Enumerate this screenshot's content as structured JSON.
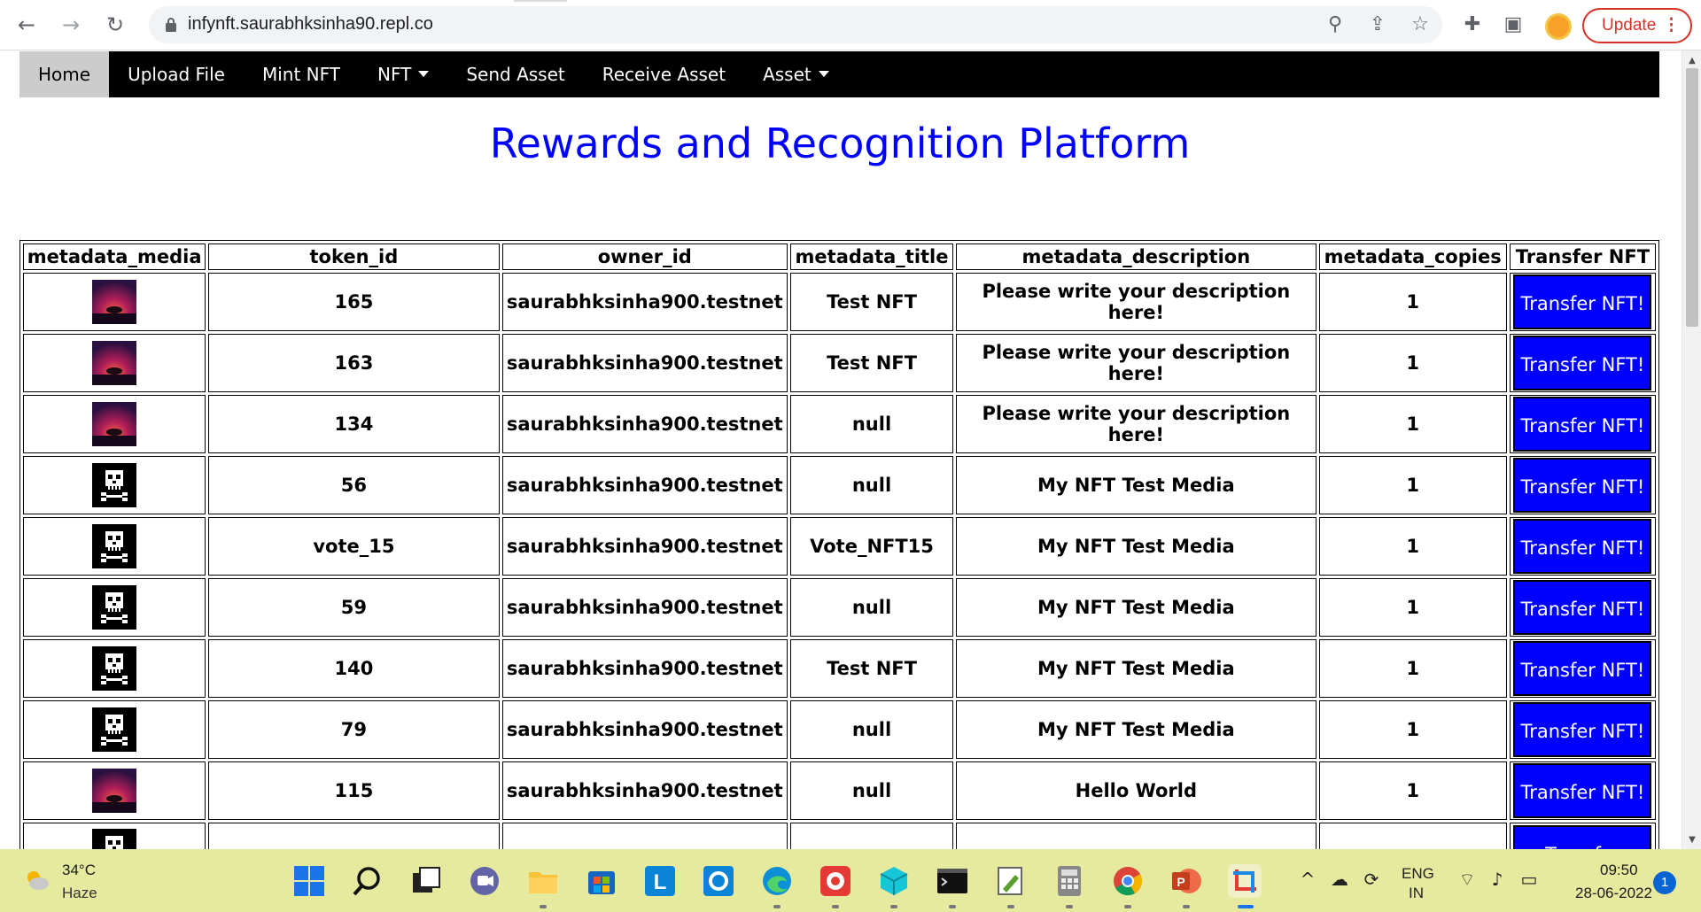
{
  "browser": {
    "url": "infynft.saurabhksinha90.repl.co",
    "update_label": "Update",
    "menu_dots": "⋮"
  },
  "nav": {
    "home": "Home",
    "upload": "Upload File",
    "mint": "Mint NFT",
    "nft": "NFT",
    "send": "Send Asset",
    "receive": "Receive Asset",
    "asset": "Asset"
  },
  "page_title": "Rewards and Recognition Platform",
  "table": {
    "headers": [
      "metadata_media",
      "token_id",
      "owner_id",
      "metadata_title",
      "metadata_description",
      "metadata_copies",
      "Transfer NFT"
    ],
    "button_label": "Transfer NFT!",
    "partial_button_label": "Transfer",
    "rows": [
      {
        "media": "sunset-tree-image",
        "token_id": "165",
        "owner_id": "saurabhksinha900.testnet",
        "title": "Test NFT",
        "description": "Please write your description here!",
        "copies": "1"
      },
      {
        "media": "sunset-tree-image",
        "token_id": "163",
        "owner_id": "saurabhksinha900.testnet",
        "title": "Test NFT",
        "description": "Please write your description here!",
        "copies": "1"
      },
      {
        "media": "sunset-tree-image",
        "token_id": "134",
        "owner_id": "saurabhksinha900.testnet",
        "title": "null",
        "description": "Please write your description here!",
        "copies": "1"
      },
      {
        "media": "pixel-skull-image",
        "token_id": "56",
        "owner_id": "saurabhksinha900.testnet",
        "title": "null",
        "description": "My NFT Test Media",
        "copies": "1"
      },
      {
        "media": "pixel-skull-image",
        "token_id": "vote_15",
        "owner_id": "saurabhksinha900.testnet",
        "title": "Vote_NFT15",
        "description": "My NFT Test Media",
        "copies": "1"
      },
      {
        "media": "pixel-skull-image",
        "token_id": "59",
        "owner_id": "saurabhksinha900.testnet",
        "title": "null",
        "description": "My NFT Test Media",
        "copies": "1"
      },
      {
        "media": "pixel-skull-image",
        "token_id": "140",
        "owner_id": "saurabhksinha900.testnet",
        "title": "Test NFT",
        "description": "My NFT Test Media",
        "copies": "1"
      },
      {
        "media": "pixel-skull-image",
        "token_id": "79",
        "owner_id": "saurabhksinha900.testnet",
        "title": "null",
        "description": "My NFT Test Media",
        "copies": "1"
      },
      {
        "media": "sunset-tree-image",
        "token_id": "115",
        "owner_id": "saurabhksinha900.testnet",
        "title": "null",
        "description": "Hello World",
        "copies": "1"
      }
    ]
  },
  "taskbar": {
    "temperature": "34°C",
    "weather": "Haze",
    "lang_top": "ENG",
    "lang_bottom": "IN",
    "time": "09:50",
    "date": "28-06-2022",
    "notifications": "1"
  }
}
